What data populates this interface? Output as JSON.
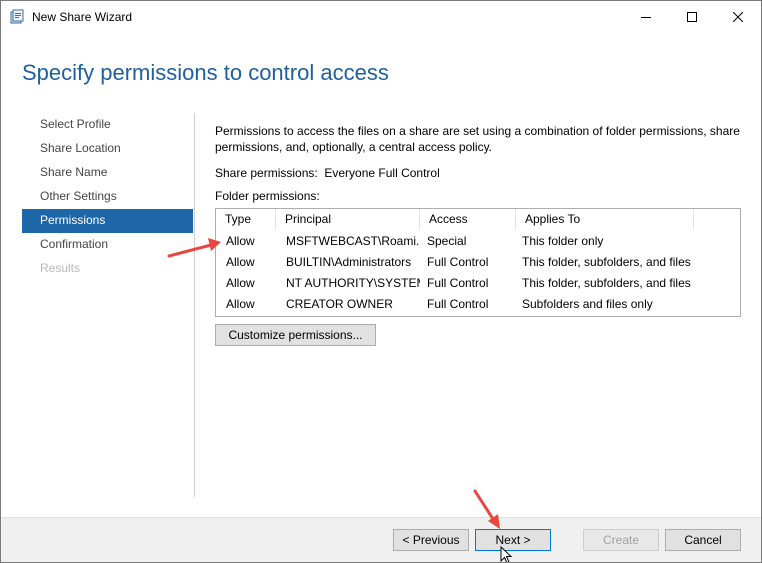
{
  "window": {
    "title": "New Share Wizard",
    "icon": "share-wizard-icon",
    "controls": [
      "minimize-icon",
      "maximize-icon",
      "close-icon"
    ]
  },
  "page": {
    "title": "Specify permissions to control access"
  },
  "nav": {
    "items": [
      {
        "label": "Select Profile",
        "state": "normal"
      },
      {
        "label": "Share Location",
        "state": "normal"
      },
      {
        "label": "Share Name",
        "state": "normal"
      },
      {
        "label": "Other Settings",
        "state": "normal"
      },
      {
        "label": "Permissions",
        "state": "active"
      },
      {
        "label": "Confirmation",
        "state": "normal"
      },
      {
        "label": "Results",
        "state": "disabled"
      }
    ]
  },
  "main": {
    "description": "Permissions to access the files on a share are set using a combination of folder permissions, share permissions, and, optionally, a central access policy.",
    "share_permissions": "Share permissions:  Everyone Full Control",
    "folder_permissions_label": "Folder permissions:",
    "table": {
      "columns": [
        "Type",
        "Principal",
        "Access",
        "Applies To"
      ],
      "rows": [
        [
          "Allow",
          "MSFTWEBCAST\\Roami...",
          "Special",
          "This folder only"
        ],
        [
          "Allow",
          "BUILTIN\\Administrators",
          "Full Control",
          "This folder, subfolders, and files"
        ],
        [
          "Allow",
          "NT AUTHORITY\\SYSTEM",
          "Full Control",
          "This folder, subfolders, and files"
        ],
        [
          "Allow",
          "CREATOR OWNER",
          "Full Control",
          "Subfolders and files only"
        ]
      ]
    },
    "customize_button": "Customize permissions..."
  },
  "footer": {
    "previous": "< Previous",
    "next": "Next >",
    "create": "Create",
    "cancel": "Cancel"
  },
  "colors": {
    "accent": "#1d66a8",
    "title": "#1e5f9e",
    "annotation_arrow": "#e8463f"
  }
}
